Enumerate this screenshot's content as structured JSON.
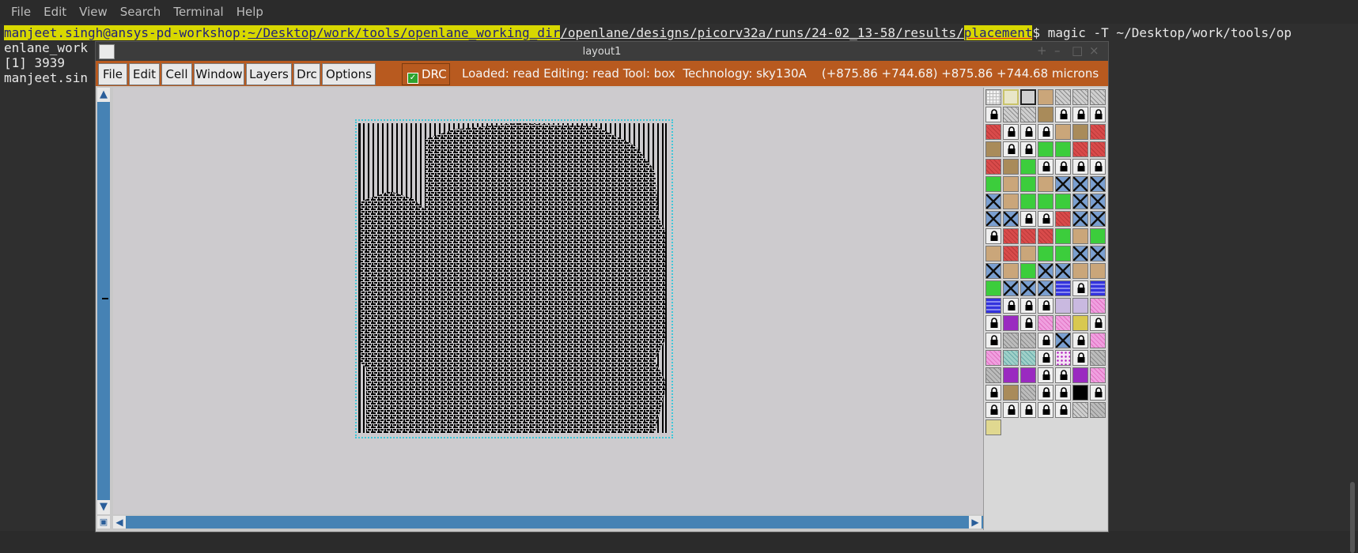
{
  "terminal": {
    "menu": [
      "File",
      "Edit",
      "View",
      "Search",
      "Terminal",
      "Help"
    ],
    "prompt_user": "manjeet.singh@ansys-pd-workshop",
    "prompt_sep": ":",
    "path_prefix": "~/Desktop/work/tools/openlane_working_dir",
    "path_mid": "/openlane/designs/picorv32a/runs/24-02_13-58/results/",
    "path_highlight": "placement",
    "command": "$ magic -T ~/Desktop/work/tools/op",
    "line2": "enlane_work",
    "line3": "[1] 3939",
    "line4": "manjeet.sin"
  },
  "window": {
    "title": "layout1",
    "menus": [
      "File",
      "Edit",
      "Cell",
      "Window",
      "Layers",
      "Drc",
      "Options"
    ],
    "drc_label": "DRC",
    "drc_checked": true,
    "status": "Loaded: read Editing: read Tool: box  Technology: sky130A    (+875.86 +744.68) +875.86 +744.68 microns"
  },
  "colors": {
    "toolbar": "#b85a1f",
    "scrollbar": "#4682b4",
    "canvas": "#cdcbce",
    "terminal_bg": "#2f2f2f",
    "highlight": "#d8d800"
  },
  "palette_rows": [
    [
      "grid",
      "yellowbox",
      "box",
      "tan",
      "hatch",
      "hatch",
      "hatch"
    ],
    [
      "lock",
      "hatch",
      "hatch",
      "brown",
      "lock",
      "lock",
      "lock"
    ],
    [
      "red",
      "lock",
      "lock",
      "lock",
      "tan",
      "brown",
      "red"
    ],
    [
      "brown",
      "lock",
      "lock",
      "green",
      "green",
      "red",
      "red"
    ],
    [
      "red",
      "brown",
      "green",
      "lock",
      "lock",
      "lock",
      "lock"
    ],
    [
      "green",
      "tan",
      "green",
      "tan",
      "x",
      "x",
      "x"
    ],
    [
      "x",
      "tan",
      "green",
      "green",
      "green",
      "x",
      "x"
    ],
    [
      "x",
      "x",
      "lock",
      "lock",
      "red",
      "x",
      "x"
    ],
    [
      "lock",
      "red",
      "red",
      "red",
      "green",
      "tan",
      "green"
    ],
    [
      "tan",
      "red",
      "tan",
      "green",
      "green",
      "x",
      "x"
    ],
    [
      "x",
      "tan",
      "green",
      "x",
      "x",
      "tan",
      "tan"
    ],
    [
      "green",
      "x",
      "x",
      "x",
      "blue",
      "lock",
      "blue"
    ],
    [
      "blue",
      "lock",
      "lock",
      "lock",
      "lavender",
      "lavender",
      "pink"
    ],
    [
      "lock",
      "purple",
      "lock",
      "pink",
      "pink",
      "yellow",
      "lock"
    ],
    [
      "lock",
      "grey",
      "grey",
      "lock",
      "x",
      "lock",
      "pink"
    ],
    [
      "pink",
      "teal",
      "teal",
      "lock",
      "dots",
      "lock",
      "grey"
    ],
    [
      "grey",
      "purple",
      "purple",
      "lock",
      "lock",
      "purple",
      "pink"
    ],
    [
      "lock",
      "brown",
      "grey",
      "lock",
      "lock",
      "black",
      "lock"
    ],
    [
      "lock",
      "lock",
      "lock",
      "lock",
      "lock",
      "hatch",
      "grey"
    ],
    [
      "paleyellow"
    ]
  ]
}
